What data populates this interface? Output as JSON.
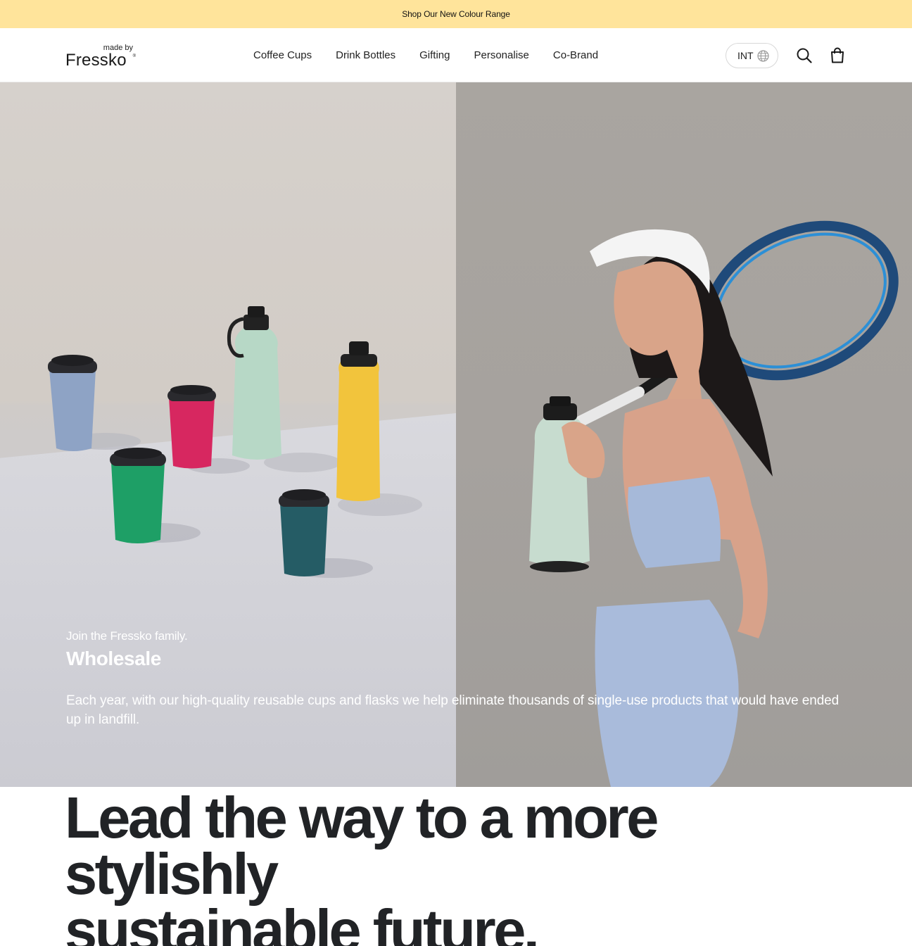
{
  "announcement": {
    "text": "Shop Our New Colour Range"
  },
  "header": {
    "logo": {
      "made_by": "made by",
      "brand": "Fressko",
      "reg": "®"
    },
    "nav": [
      "Coffee Cups",
      "Drink Bottles",
      "Gifting",
      "Personalise",
      "Co-Brand"
    ],
    "region": {
      "label": "INT",
      "icon": "globe-icon"
    },
    "search_icon": "search-icon",
    "bag_icon": "shopping-bag-icon"
  },
  "hero": {
    "eyebrow": "Join the Fressko family.",
    "title": "Wholesale",
    "description": "Each year, with our high-quality reusable cups and flasks we help eliminate thousands of single-use products that would have ended up in landfill."
  },
  "lead": {
    "line1": "Lead the way to a more stylishly",
    "line2": "sustainable future."
  },
  "colors": {
    "announcement_bg": "#ffe49b",
    "text_dark": "#212326",
    "cup_blue": "#8aa0c4",
    "cup_pink": "#d5245f",
    "cup_green": "#1d9e64",
    "bottle_mint": "#b5d6c4",
    "bottle_yellow": "#f2c53d",
    "cup_teal": "#245b64"
  }
}
